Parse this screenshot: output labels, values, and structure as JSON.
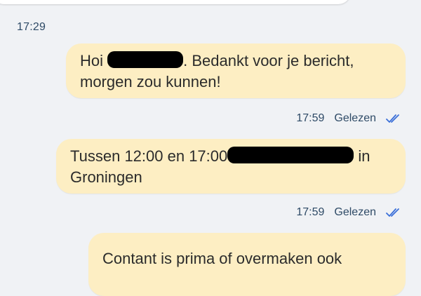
{
  "conversation": {
    "timestamp_top": "17:29",
    "messages": [
      {
        "part_before_redaction": "Hoi ",
        "part_after_redaction": ". Bedankt voor je bericht,",
        "line2": "morgen zou kunnen!",
        "time": "17:59",
        "status": "Gelezen",
        "status_icon": "double-check-icon"
      },
      {
        "part_before_redaction": "Tussen 12:00 en 17:00",
        "part_after_redaction": " in",
        "line2": "Groningen",
        "time": "17:59",
        "status": "Gelezen",
        "status_icon": "double-check-icon"
      },
      {
        "text": "Contant is prima of overmaken ook"
      }
    ]
  },
  "colors": {
    "background": "#f0f2f5",
    "outgoing_bubble": "#fdeec3",
    "incoming_bubble": "#ffffff",
    "meta_text": "#2e4a66",
    "read_check": "#3a6fd8"
  }
}
